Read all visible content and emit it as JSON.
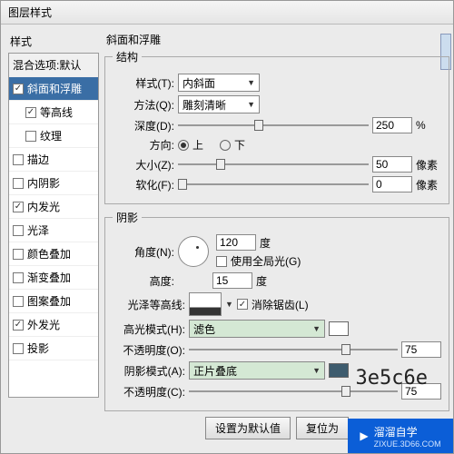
{
  "window": {
    "title": "图层样式"
  },
  "sidebar": {
    "label": "样式",
    "items": [
      {
        "label": "混合选项:默认",
        "checked": null,
        "selected": false,
        "indent": false
      },
      {
        "label": "斜面和浮雕",
        "checked": true,
        "selected": true,
        "indent": false
      },
      {
        "label": "等高线",
        "checked": true,
        "selected": false,
        "indent": true
      },
      {
        "label": "纹理",
        "checked": false,
        "selected": false,
        "indent": true
      },
      {
        "label": "描边",
        "checked": false,
        "selected": false,
        "indent": false
      },
      {
        "label": "内阴影",
        "checked": false,
        "selected": false,
        "indent": false
      },
      {
        "label": "内发光",
        "checked": true,
        "selected": false,
        "indent": false
      },
      {
        "label": "光泽",
        "checked": false,
        "selected": false,
        "indent": false
      },
      {
        "label": "颜色叠加",
        "checked": false,
        "selected": false,
        "indent": false
      },
      {
        "label": "渐变叠加",
        "checked": false,
        "selected": false,
        "indent": false
      },
      {
        "label": "图案叠加",
        "checked": false,
        "selected": false,
        "indent": false
      },
      {
        "label": "外发光",
        "checked": true,
        "selected": false,
        "indent": false
      },
      {
        "label": "投影",
        "checked": false,
        "selected": false,
        "indent": false
      }
    ]
  },
  "panel": {
    "title": "斜面和浮雕",
    "structure": {
      "legend": "结构",
      "style_label": "样式(T):",
      "style_value": "内斜面",
      "technique_label": "方法(Q):",
      "technique_value": "雕刻清晰",
      "depth_label": "深度(D):",
      "depth_value": "250",
      "depth_unit": "%",
      "direction_label": "方向:",
      "dir_up": "上",
      "dir_down": "下",
      "size_label": "大小(Z):",
      "size_value": "50",
      "size_unit": "像素",
      "soften_label": "软化(F):",
      "soften_value": "0",
      "soften_unit": "像素"
    },
    "shading": {
      "legend": "阴影",
      "angle_label": "角度(N):",
      "angle_value": "120",
      "angle_unit": "度",
      "global_label": "使用全局光(G)",
      "altitude_label": "高度:",
      "altitude_value": "15",
      "altitude_unit": "度",
      "gloss_label": "光泽等高线:",
      "antialias_label": "消除锯齿(L)",
      "hlmode_label": "高光模式(H):",
      "hlmode_value": "滤色",
      "hlopacity_label": "不透明度(O):",
      "hlopacity_value": "75",
      "shmode_label": "阴影模式(A):",
      "shmode_value": "正片叠底",
      "shopacity_label": "不透明度(C):",
      "shopacity_value": "75"
    },
    "buttons": {
      "default": "设置为默认值",
      "reset": "复位为"
    }
  },
  "autotext": "3e5c6e",
  "watermark": {
    "brand": "溜溜自学",
    "url": "ZIXUE.3D66.COM"
  }
}
